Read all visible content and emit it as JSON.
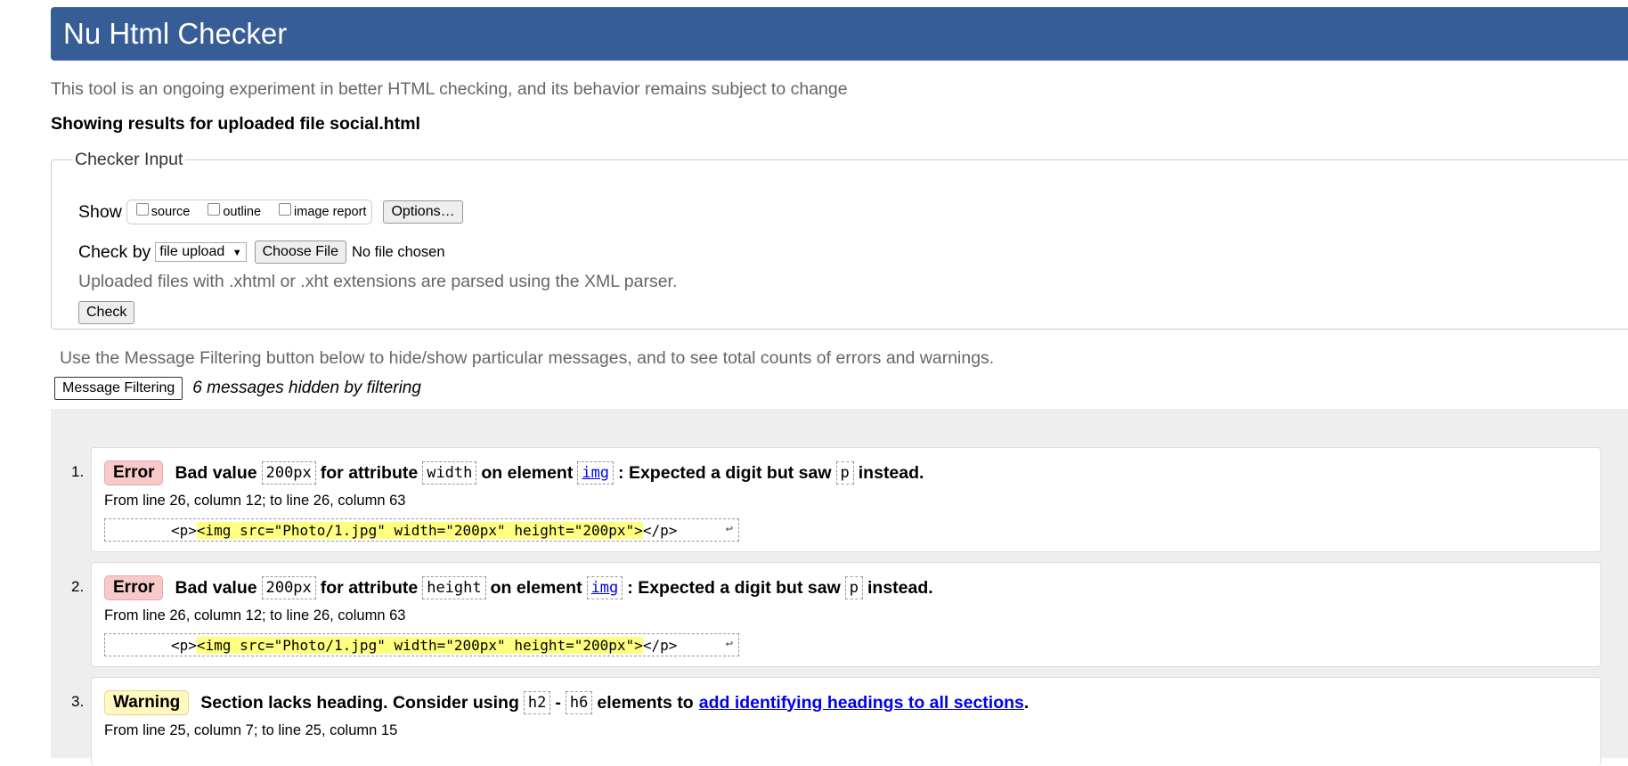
{
  "header": {
    "title": "Nu Html Checker"
  },
  "intro": "This tool is an ongoing experiment in better HTML checking, and its behavior remains subject to change",
  "results_heading": "Showing results for uploaded file social.html",
  "checker_input": {
    "legend": "Checker Input",
    "show_label": "Show",
    "show_options": [
      "source",
      "outline",
      "image report"
    ],
    "options_button": "Options…",
    "check_by_label": "Check by",
    "check_by_value": "file upload",
    "choose_file_button": "Choose File",
    "no_file_text": "No file chosen",
    "hint": "Uploaded files with .xhtml or .xht extensions are parsed using the XML parser.",
    "check_button": "Check"
  },
  "filtering": {
    "note": "Use the Message Filtering button below to hide/show particular messages, and to see total counts of errors and warnings.",
    "button": "Message Filtering",
    "hidden_count": "6 messages hidden by filtering"
  },
  "messages": [
    {
      "number": "1.",
      "type": "Error",
      "parts": [
        "Bad value",
        "200px",
        "for attribute",
        "width",
        "on element",
        "img",
        ": Expected a digit but saw",
        "p",
        "instead."
      ],
      "location": "From line 26, column 12; to line 26, column 63",
      "extract_lead": "<p>",
      "extract_highlight": "<img src=\"Photo/1.jpg\" width=\"200px\" height=\"200px\">",
      "extract_tail": "</p>"
    },
    {
      "number": "2.",
      "type": "Error",
      "parts": [
        "Bad value",
        "200px",
        "for attribute",
        "height",
        "on element",
        "img",
        ": Expected a digit but saw",
        "p",
        "instead."
      ],
      "location": "From line 26, column 12; to line 26, column 63",
      "extract_lead": "<p>",
      "extract_highlight": "<img src=\"Photo/1.jpg\" width=\"200px\" height=\"200px\">",
      "extract_tail": "</p>"
    },
    {
      "number": "3.",
      "type": "Warning",
      "parts": [
        "Section lacks heading. Consider using",
        "h2",
        "-",
        "h6",
        "elements to",
        "add identifying headings to all sections",
        "."
      ],
      "location": "From line 25, column 7; to line 25, column 15"
    }
  ],
  "icons": {
    "wrap": "return-arrow-icon"
  },
  "colors": {
    "header_bg": "#365d95",
    "error_badge": "#f8c9c9",
    "warning_badge": "#fff8c0",
    "highlight": "#ffff80"
  }
}
